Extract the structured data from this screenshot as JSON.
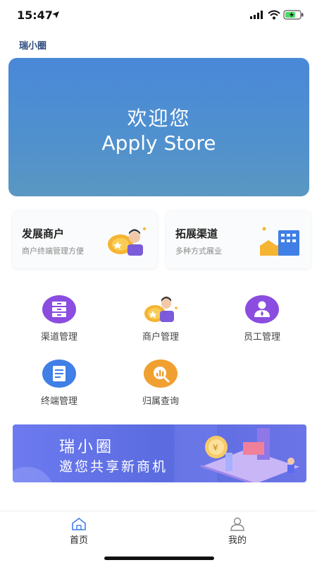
{
  "status_bar": {
    "time": "15:47"
  },
  "header": {
    "app_title": "瑞小圈"
  },
  "banner": {
    "line1": "欢迎您",
    "line2": "Apply Store"
  },
  "cards": [
    {
      "title": "发展商户",
      "subtitle": "商户终端管理方便",
      "icon": "merchant-coin-icon"
    },
    {
      "title": "拓展渠道",
      "subtitle": "多种方式展业",
      "icon": "channel-building-icon"
    }
  ],
  "menu": [
    {
      "label": "渠道管理",
      "icon": "cabinet-icon"
    },
    {
      "label": "商户管理",
      "icon": "merchant-person-icon"
    },
    {
      "label": "员工管理",
      "icon": "staff-icon"
    },
    {
      "label": "终端管理",
      "icon": "document-icon"
    },
    {
      "label": "归属查询",
      "icon": "magnifier-chart-icon"
    }
  ],
  "promo": {
    "line1": "瑞小圈",
    "line2": "邀您共享新商机"
  },
  "tabs": [
    {
      "label": "首页",
      "icon": "home-icon"
    },
    {
      "label": "我的",
      "icon": "profile-icon"
    }
  ],
  "colors": {
    "banner": "#4a88d8",
    "accent_purple": "#8a4de0",
    "accent_blue": "#3f7fe6",
    "accent_orange": "#f0a030",
    "promo": "#6d7af0"
  }
}
